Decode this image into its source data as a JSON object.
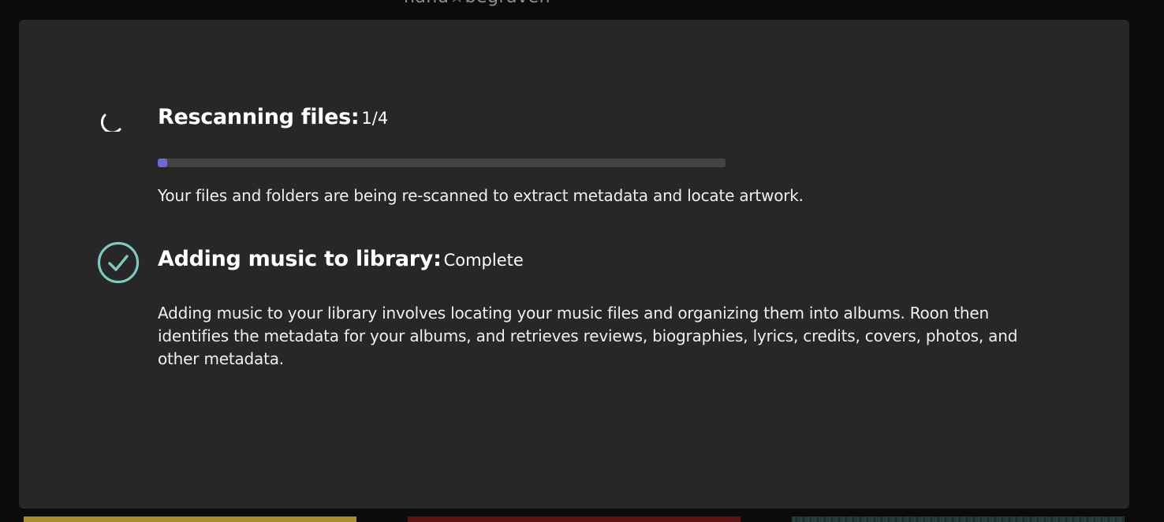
{
  "background": {
    "title": "hand☆begraven"
  },
  "sections": [
    {
      "title": "Rescanning files:",
      "status": "1/4",
      "description": "Your files and folders are being re-scanned to extract metadata and locate artwork.",
      "icon": "spinner-icon",
      "progress_percent": 1.7
    },
    {
      "title": "Adding music to library:",
      "status": "Complete",
      "description": "Adding music to your library involves locating your music files and organizing them into albums. Roon then identifies the metadata for your albums, and retrieves reviews, biographies, lyrics, credits, covers, photos, and other metadata.",
      "icon": "check-circle-icon"
    }
  ],
  "colors": {
    "dialog_background": "#272727",
    "progress_fill": "#6b6bd7",
    "check_color": "#7ec9c0"
  }
}
